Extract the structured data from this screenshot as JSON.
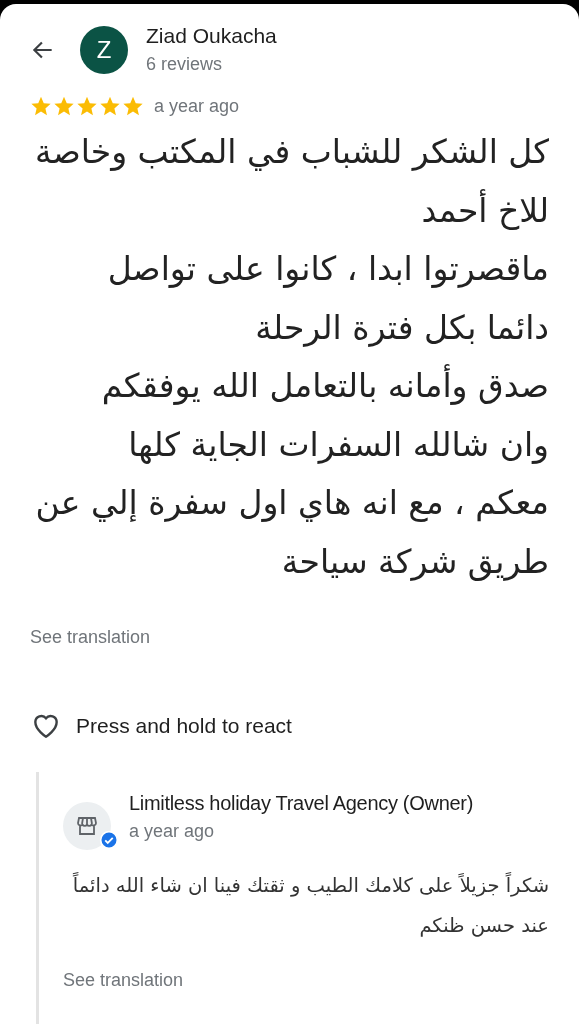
{
  "reviewer": {
    "initial": "Z",
    "name": "Ziad Oukacha",
    "reviews": "6 reviews"
  },
  "review": {
    "stars": 5,
    "time": "a year ago",
    "lines": [
      "كل الشكر للشباب في المكتب وخاصة",
      "للاخ أحمد",
      "ماقصرتوا ابدا ، كانوا على تواصل",
      "دائما بكل فترة الرحلة",
      "صدق وأمانه بالتعامل الله يوفقكم",
      "وان شالله السفرات الجاية كلها",
      "معكم ، مع انه هاي اول سفرة إلي عن",
      "طريق شركة سياحة"
    ],
    "translate": "See translation"
  },
  "react": {
    "label": "Press and hold to react"
  },
  "reply": {
    "name": "Limitless holiday Travel Agency (Owner)",
    "verified": true,
    "time": "a year ago",
    "text": "شكراً جزيلاً على كلامك الطيب و ثقتك فينا ان شاء الله دائماً عند حسن ظنكم",
    "translate": "See translation"
  }
}
